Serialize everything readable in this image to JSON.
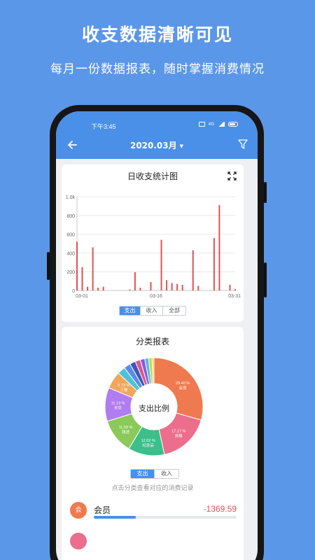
{
  "promo": {
    "title": "收支数据清晰可见",
    "subtitle": "每月一份数据报表，随时掌握消费情况"
  },
  "status_bar": {
    "time": "下午3:45",
    "network": "4G"
  },
  "app_bar": {
    "back_icon": "arrow-left-icon",
    "month": "2020.03月",
    "filter_icon": "filter-icon"
  },
  "daily_chart": {
    "title": "日收支统计图",
    "expand_icon": "expand-icon",
    "tabs": [
      "支出",
      "收入",
      "全部"
    ],
    "active_tab": "支出"
  },
  "chart_data": {
    "type": "bar",
    "title": "日收支统计图",
    "xlabel": "",
    "ylabel": "",
    "ylim": [
      0,
      1000
    ],
    "y_ticks": [
      "0",
      "200",
      "400",
      "600",
      "800",
      "1.0k"
    ],
    "x_tick_labels": [
      {
        "day": 1,
        "label": "03-01"
      },
      {
        "day": 16,
        "label": "03-16"
      },
      {
        "day": 31,
        "label": "03-31"
      }
    ],
    "bar_color": "#e05252",
    "days": [
      1,
      2,
      3,
      4,
      5,
      6,
      7,
      8,
      9,
      10,
      11,
      12,
      13,
      14,
      15,
      16,
      17,
      18,
      19,
      20,
      21,
      22,
      23,
      24,
      25,
      26,
      27,
      28,
      29,
      30,
      31
    ],
    "values": [
      520,
      250,
      40,
      460,
      30,
      40,
      0,
      0,
      0,
      0,
      10,
      195,
      30,
      0,
      90,
      0,
      540,
      110,
      80,
      70,
      60,
      0,
      430,
      50,
      0,
      0,
      560,
      910,
      0,
      60,
      15
    ]
  },
  "category_report": {
    "title": "分类报表",
    "center_label": "支出比例",
    "tabs": [
      "支出",
      "收入"
    ],
    "active_tab": "支出",
    "hint": "点击分类查看对应的消费记录",
    "slices": [
      {
        "name": "会员",
        "percent": 29.4,
        "label": "29.40 %",
        "color": "#ef7a4f"
      },
      {
        "name": "房租",
        "percent": 17.17,
        "label": "17.17 %",
        "color": "#ec6e8c"
      },
      {
        "name": "纪念品",
        "percent": 12.02,
        "label": "12.02 %",
        "color": "#3cbf8a"
      },
      {
        "name": "钱进",
        "percent": 11.59,
        "label": "11.59 %",
        "color": "#8bc95a"
      },
      {
        "name": "买花",
        "percent": 11.13,
        "label": "11.13 %",
        "color": "#b07cf0"
      },
      {
        "name": "三餐",
        "percent": 5.73,
        "label": "5.73 %",
        "color": "#f2a65a"
      },
      {
        "name": "",
        "percent": 2.6,
        "label": "",
        "color": "#4fc2d6"
      },
      {
        "name": "",
        "percent": 2.2,
        "label": "",
        "color": "#5a8de8"
      },
      {
        "name": "",
        "percent": 1.9,
        "label": "",
        "color": "#3f57b8"
      },
      {
        "name": "",
        "percent": 1.7,
        "label": "",
        "color": "#d85a8c"
      },
      {
        "name": "",
        "percent": 1.5,
        "label": "",
        "color": "#8a5ae0"
      },
      {
        "name": "",
        "percent": 1.3,
        "label": "",
        "color": "#4bbfe0"
      },
      {
        "name": "",
        "percent": 1.1,
        "label": "",
        "color": "#c8d24a"
      },
      {
        "name": "",
        "percent": 0.66,
        "label": "",
        "color": "#f0d24a"
      }
    ],
    "items": [
      {
        "icon_text": "会",
        "name": "会员",
        "amount": "-1369.59",
        "progress": 0.294
      }
    ]
  }
}
